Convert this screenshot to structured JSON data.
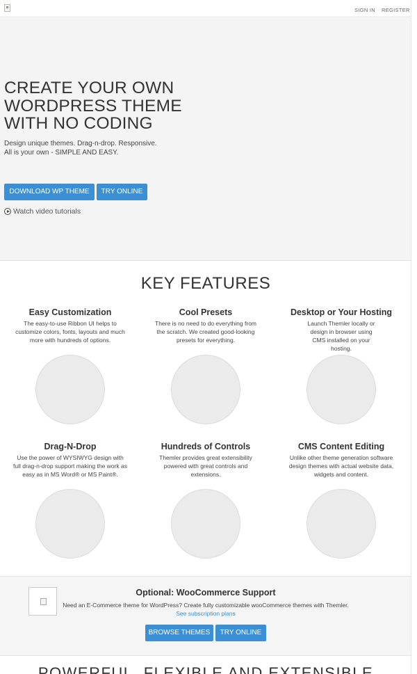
{
  "header": {
    "sign_in": "SIGN IN",
    "register": "REGISTER"
  },
  "hero": {
    "title": "CREATE YOUR OWN WORDPRESS THEME WITH NO CODING",
    "subtitle_line1": "Design unique themes. Drag-n-drop. Responsive.",
    "subtitle_line2": "All is your own - SIMPLE AND EASY.",
    "download_button": "DOWNLOAD WP THEME",
    "try_button": "TRY ONLINE",
    "video_link": "Watch video tutorials"
  },
  "features": {
    "heading": "KEY FEATURES",
    "items": [
      {
        "title": "Easy Customization",
        "desc": "The easy-to-use Ribbon UI helps to customize colors, fonts, layouts and much more with hundreds of options."
      },
      {
        "title": "Cool Presets",
        "desc": "There is no need to do everything from the scratch. We created good-looking presets for everything."
      },
      {
        "title": "Desktop or Your Hosting",
        "desc": "Launch Themler locally or design in browser using CMS installed on your hosting."
      },
      {
        "title": "Drag-N-Drop",
        "desc": "Use the power of WYSIWYG design with full drag-n-drop support making the work as easy as in MS Word® or MS Paint®."
      },
      {
        "title": "Hundreds of Controls",
        "desc": "Themler provides great extensibility powered with great controls and extensions."
      },
      {
        "title": "CMS Content Editing",
        "desc": "Unlike other theme generation software design themes with actual website data, widgets and content."
      }
    ]
  },
  "woo": {
    "title": "Optional: WooCommerce Support",
    "desc": "Need an E-Commerce theme for WordPress? Create fully customizable wooCommerce themes with Themler.",
    "link": "See subscription plans",
    "browse_button": "BROWSE THEMES",
    "try_button": "TRY ONLINE"
  },
  "bottom": {
    "heading": "POWERFUL, FLEXIBLE AND EXTENSIBLE"
  },
  "colors": {
    "accent": "#3b8fd2",
    "hero_bg": "#f4f4f4"
  }
}
